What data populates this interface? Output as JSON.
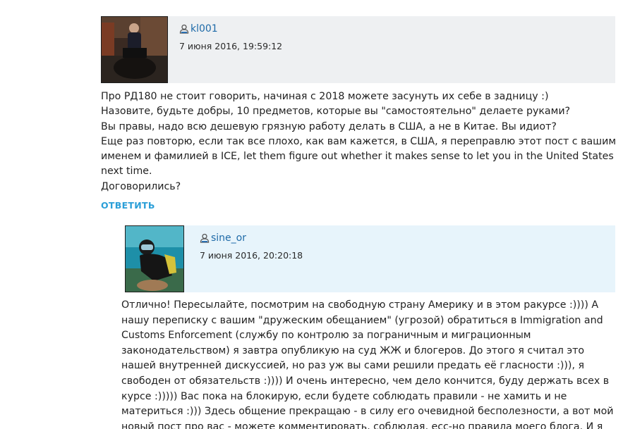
{
  "comment1": {
    "username": "kl001",
    "date": "7 июня 2016, 19:59:12",
    "lines": [
      "Про РД180 не стоит говорить, начиная с 2018 можете засунуть их себе в задницу :)",
      "Назовите, будьте добры, 10 предметов, которые вы \"самостоятельно\" делаете руками?",
      "Вы правы, надо всю дешевую грязную работу делать в США, а не в Китае. Вы идиот?",
      "Еще раз повторю, если так все плохо, как вам кажется, в США, я переправлю этот пост с вашим именем и фамилией в ICE, let them figure out whether it makes sense to let you in the United States next time.",
      "Договорились?"
    ],
    "reply_label": "ОТВЕТИТЬ"
  },
  "comment2": {
    "username": "sine_or",
    "date": "7 июня 2016, 20:20:18",
    "text": "Отлично! Пересылайте, посмотрим на свободную страну Америку и в этом ракурсе :)))) А нашу переписку с вашим \"дружеским обещанием\" (угрозой) обратиться в Immigration and Customs Enforcement (службу по контролю за пограничным и миграционным законодательством) я завтра опубликую на суд ЖЖ и блогеров. До этого я считал это нашей внутренней дискуссией, но раз уж вы сами решили предать её гласности :))), я свободен от обязательств :)))) И очень интересно, чем дело кончится, буду держать всех в курсе :))))) Вас пока на блокирую, если будете соблюдать правили - не хамить и не материться :))) Здесь общение прекращаю - в силу его очевидной бесполезности, а вот мой новый пост про вас - можете комментировать, соблюдая, есс-но правила моего блога. И я ещё очень рад, что вы работаете \"в системе"
  },
  "colors": {
    "username": "#1e6aa8",
    "reply_link": "#2b9fd8",
    "header1_bg": "#eef0f2",
    "header2_bg": "#e7f4fb"
  },
  "icons": [
    "user-icon"
  ]
}
